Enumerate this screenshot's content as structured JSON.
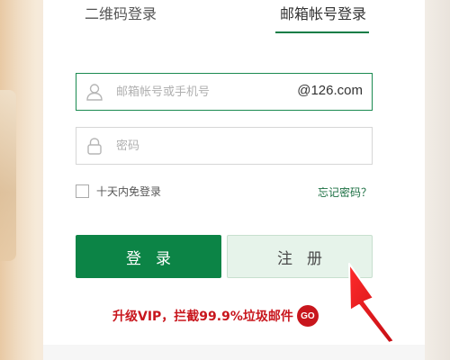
{
  "tabs": {
    "qr_login": "二维码登录",
    "mail_login": "邮箱帐号登录"
  },
  "username": {
    "placeholder": "邮箱帐号或手机号",
    "suffix": "@126.com",
    "icon": "user-icon"
  },
  "password": {
    "placeholder": "密码",
    "icon": "lock-icon"
  },
  "remember": {
    "label": "十天内免登录",
    "checked": false
  },
  "forgot_label": "忘记密码？",
  "buttons": {
    "login": "登录",
    "register": "注册"
  },
  "promo": {
    "text": "升级VIP，拦截99.9%垃圾邮件",
    "badge": "GO"
  },
  "colors": {
    "brand_green": "#0c8446",
    "promo_red": "#c8161d",
    "arrow_red": "#e0141b"
  }
}
